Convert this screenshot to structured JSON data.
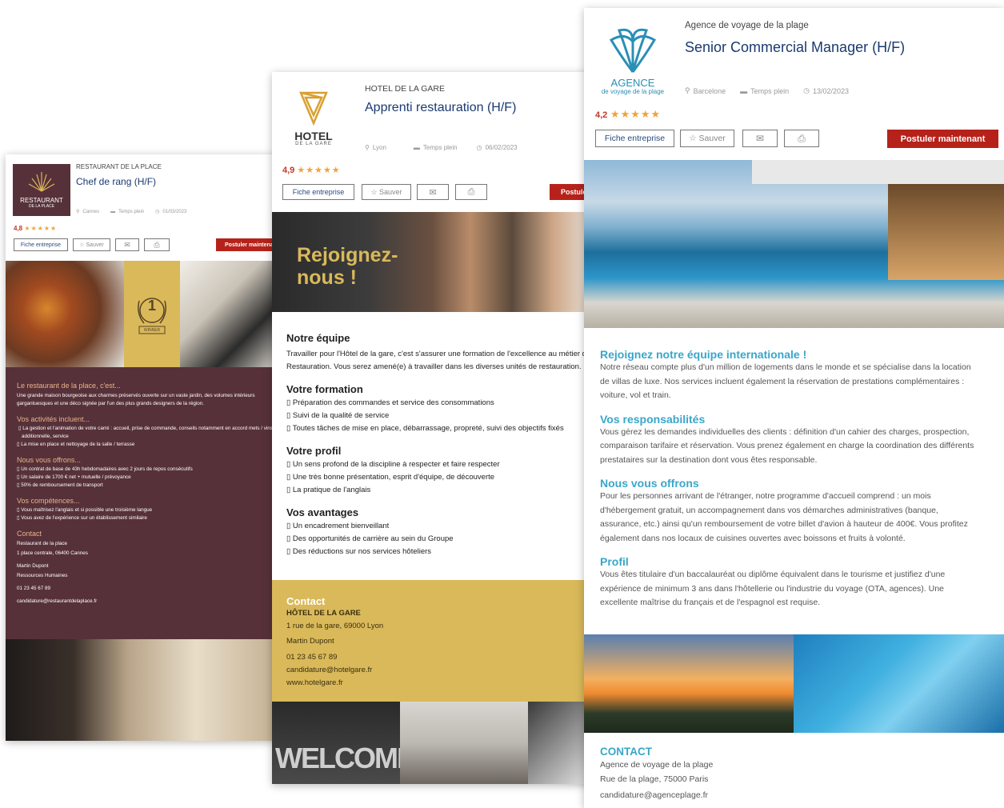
{
  "card1": {
    "company": "RESTAURANT DE LA PLACE",
    "title": "Chef de rang (H/F)",
    "logo_line1": "RESTAURANT",
    "logo_line2": "DE LA PLACE",
    "location": "Cannes",
    "contract": "Temps plein",
    "date": "01/03/2023",
    "rating": "4,8",
    "stars": "★★★★★",
    "btn_company": "Fiche entreprise",
    "btn_save": "Sauver",
    "btn_apply": "Postuler maintenant",
    "badge_number": "1",
    "badge_text": "WINNER",
    "intro_title": "Le restaurant de la place, c'est...",
    "intro_text": "Une grande maison bourgeoise aux charmes préservés ouverte sur un vaste jardin, des volumes intérieurs gargantuesques et une déco signée par l'un des plus grands designers de la région.",
    "activities_title": "Vos activités incluent...",
    "activities": [
      "La gestion et l'animation de votre carré : accueil, prise de commande, conseils notamment en accord mets / vins, vente additionnelle, service",
      "La mise en place et nettoyage de la salle / terrasse"
    ],
    "offers_title": "Nous vous offrons...",
    "offers": [
      "Un contrat de base de 43h hebdomadaires avec 2 jours de repos consécutifs",
      "Un salaire de 1700 € net + mutuelle / prévoyance",
      "50% de remboursement de transport"
    ],
    "skills_title": "Vos compétences...",
    "skills": [
      "Vous maîtrisez l'anglais et si possible une troisième langue",
      "Vous avez de l'expérience sur un établissement similaire"
    ],
    "contact_title": "Contact",
    "contact_name": "Restaurant de la place",
    "contact_address": "1 place centrale, 06400 Cannes",
    "contact_person": "Martin Dupont",
    "contact_dept": "Ressources Humaines",
    "contact_phone": "01 23 45 67 89",
    "contact_email": "candidature@restaurantdelaplace.fr"
  },
  "card2": {
    "company": "HOTEL DE LA GARE",
    "title": "Apprenti restauration (H/F)",
    "logo_line1": "HOTEL",
    "logo_line2": "DE LA GARE",
    "location": "Lyon",
    "contract": "Temps plein",
    "date": "06/02/2023",
    "rating": "4,9",
    "stars": "★★★★★",
    "btn_company": "Fiche entreprise",
    "btn_save": "Sauver",
    "btn_apply": "Postuler maintenant",
    "hero_text": "Rejoignez-nous !",
    "team_title": "Notre équipe",
    "team_text": "Travailler pour l'Hôtel de la gare, c'est s'assurer une formation de l'excellence au métier de la Restauration. Vous serez amené(e) à travailler dans les diverses unités de restauration.",
    "training_title": "Votre formation",
    "training": [
      "Préparation des commandes et service des consommations",
      "Suivi de la qualité de service",
      "Toutes tâches de mise en place, débarrassage, propreté, suivi des objectifs fixés"
    ],
    "profile_title": "Votre profil",
    "profile": [
      "Un sens profond de la discipline à respecter et faire respecter",
      "Une très bonne présentation, esprit d'équipe, de découverte",
      "La pratique de l'anglais"
    ],
    "benefits_title": "Vos avantages",
    "benefits": [
      "Un encadrement bienveillant",
      "Des opportunités de carrière au sein du Groupe",
      "Des réductions sur nos services hôteliers"
    ],
    "contact_title": "Contact",
    "contact_name": "HÔTEL DE LA GARE",
    "contact_address": "1 rue de la gare, 69000 Lyon",
    "contact_person": "Martin Dupont",
    "contact_phone": "01 23 45 67 89",
    "contact_email": "candidature@hotelgare.fr",
    "contact_web": "www.hotelgare.fr",
    "welcome_text": "WELCOME"
  },
  "card3": {
    "company": "Agence de voyage de la plage",
    "title": "Senior Commercial Manager (H/F)",
    "logo_line1": "AGENCE",
    "logo_line2": "de voyage de la plage",
    "location": "Barcelone",
    "contract": "Temps plein",
    "date": "13/02/2023",
    "rating": "4,2",
    "stars": "★★★★★",
    "btn_company": "Fiche entreprise",
    "btn_save": "Sauver",
    "btn_apply": "Postuler maintenant",
    "join_title": "Rejoignez notre équipe internationale !",
    "join_text": "Notre réseau compte plus d'un million de logements dans le monde et se spécialise dans la location de villas de luxe. Nos services incluent également la réservation de prestations complémentaires : voiture, vol et train.",
    "resp_title": "Vos responsabilités",
    "resp_text": "Vous gérez les demandes individuelles des clients : définition d'un cahier des charges, prospection, comparaison tarifaire et réservation. Vous prenez également en charge la coordination des différents prestataires sur la destination dont vous êtes responsable.",
    "offer_title": "Nous vous offrons",
    "offer_text": "Pour les personnes arrivant de l'étranger, notre programme d'accueil comprend : un mois d'hébergement gratuit, un accompagnement dans vos démarches administratives (banque, assurance, etc.) ainsi qu'un remboursement de votre billet d'avion à hauteur de 400€. Vous profitez également dans nos locaux de cuisines ouvertes avec boissons et fruits à volonté.",
    "profile_title": "Profil",
    "profile_text": "Vous êtes titulaire d'un baccalauréat ou diplôme équivalent dans le tourisme et justifiez d'une expérience de minimum 3 ans dans l'hôtellerie ou l'industrie du voyage (OTA, agences). Une excellente maîtrise du français et de l'espagnol est requise.",
    "contact_title": "CONTACT",
    "contact_name": "Agence de voyage de la plage",
    "contact_address": "Rue de la plage, 75000 Paris",
    "contact_email": "candidature@agenceplage.fr"
  },
  "colors": {
    "maroon": "#573139",
    "gold": "#d9b95a",
    "teal": "#3aa6c9",
    "navy": "#1a3a70",
    "red": "#b6221a"
  }
}
